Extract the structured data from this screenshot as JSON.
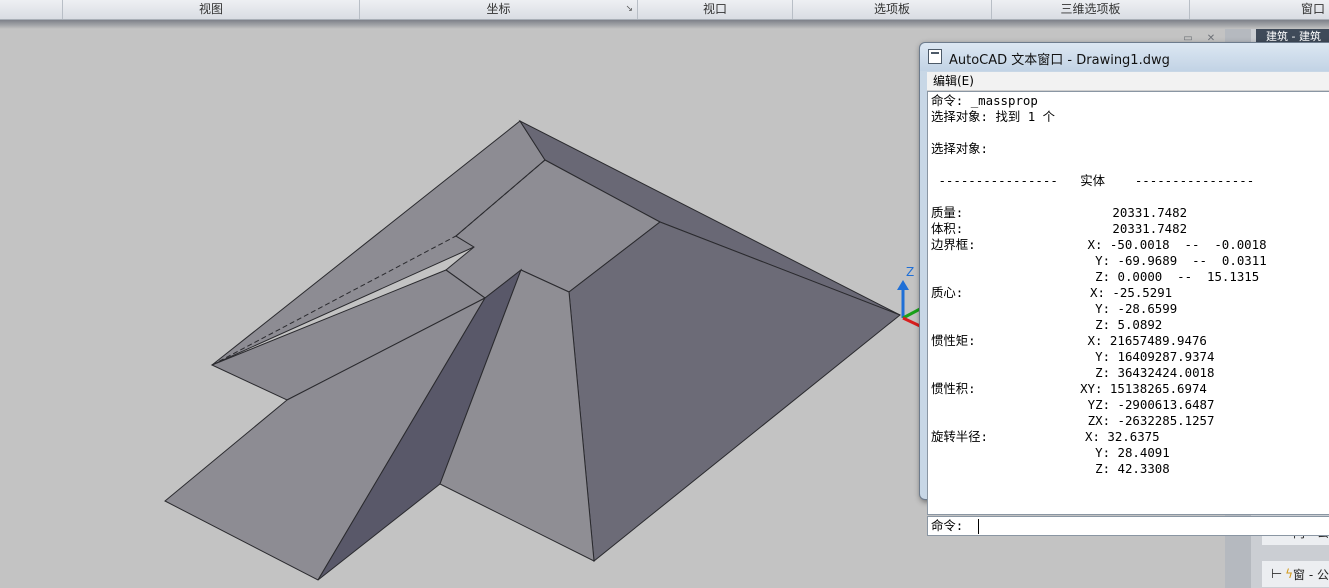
{
  "ribbon": {
    "panels": [
      {
        "label": "视图"
      },
      {
        "label": "坐标",
        "has_launcher": true
      },
      {
        "label": "视口"
      },
      {
        "label": "选项板"
      },
      {
        "label": "三维选项板"
      },
      {
        "label": "窗口"
      }
    ],
    "launcher_glyph": "↘"
  },
  "viewport": {
    "ucs_icon": {
      "z_label": "Z",
      "colors": {
        "x": "#d81e1e",
        "y": "#1aa21a",
        "z": "#1f6fd6"
      }
    },
    "model": {
      "description_colors": {
        "top": "#8e8d94",
        "face_dark": "#6c6b78",
        "face_darker": "#595869",
        "face_light": "#9a999f"
      }
    }
  },
  "tool_palette": {
    "tab_label": "建筑 - 建筑",
    "items": [
      {
        "label": "门 - 公",
        "icon": "door-tool-icon"
      },
      {
        "label": "窗 - 公",
        "icon": "window-tool-icon"
      }
    ]
  },
  "text_window": {
    "title": "AutoCAD 文本窗口 - Drawing1.dwg",
    "menu": {
      "edit": "编辑(E)"
    },
    "lines": [
      {
        "text": "命令: _massprop"
      },
      {
        "text": "选择对象: 找到 1 个"
      },
      {
        "text": ""
      },
      {
        "text": "选择对象:"
      },
      {
        "text": ""
      },
      {
        "text": " ----------------   实体    ----------------"
      },
      {
        "text": ""
      },
      {
        "text": "质量:                    20331.7482"
      },
      {
        "text": "体积:                    20331.7482"
      },
      {
        "text": "边界框:               X: -50.0018  --  -0.0018"
      },
      {
        "text": "                      Y: -69.9689  --  0.0311"
      },
      {
        "text": "                      Z: 0.0000  --  15.1315"
      },
      {
        "text": "质心:                 X: -25.5291"
      },
      {
        "text": "                      Y: -28.6599"
      },
      {
        "text": "                      Z: 5.0892"
      },
      {
        "text": "惯性矩:               X: 21657489.9476"
      },
      {
        "text": "                      Y: 16409287.9374"
      },
      {
        "text": "                      Z: 36432424.0018"
      },
      {
        "text": "惯性积:              XY: 15138265.6974"
      },
      {
        "text": "                     YZ: -2900613.6487"
      },
      {
        "text": "                     ZX: -2632285.1257"
      },
      {
        "text": "旋转半径:             X: 32.6375"
      },
      {
        "text": "                      Y: 28.4091"
      },
      {
        "text": "                      Z: 42.3308"
      }
    ],
    "command_prompt": "命令:"
  }
}
